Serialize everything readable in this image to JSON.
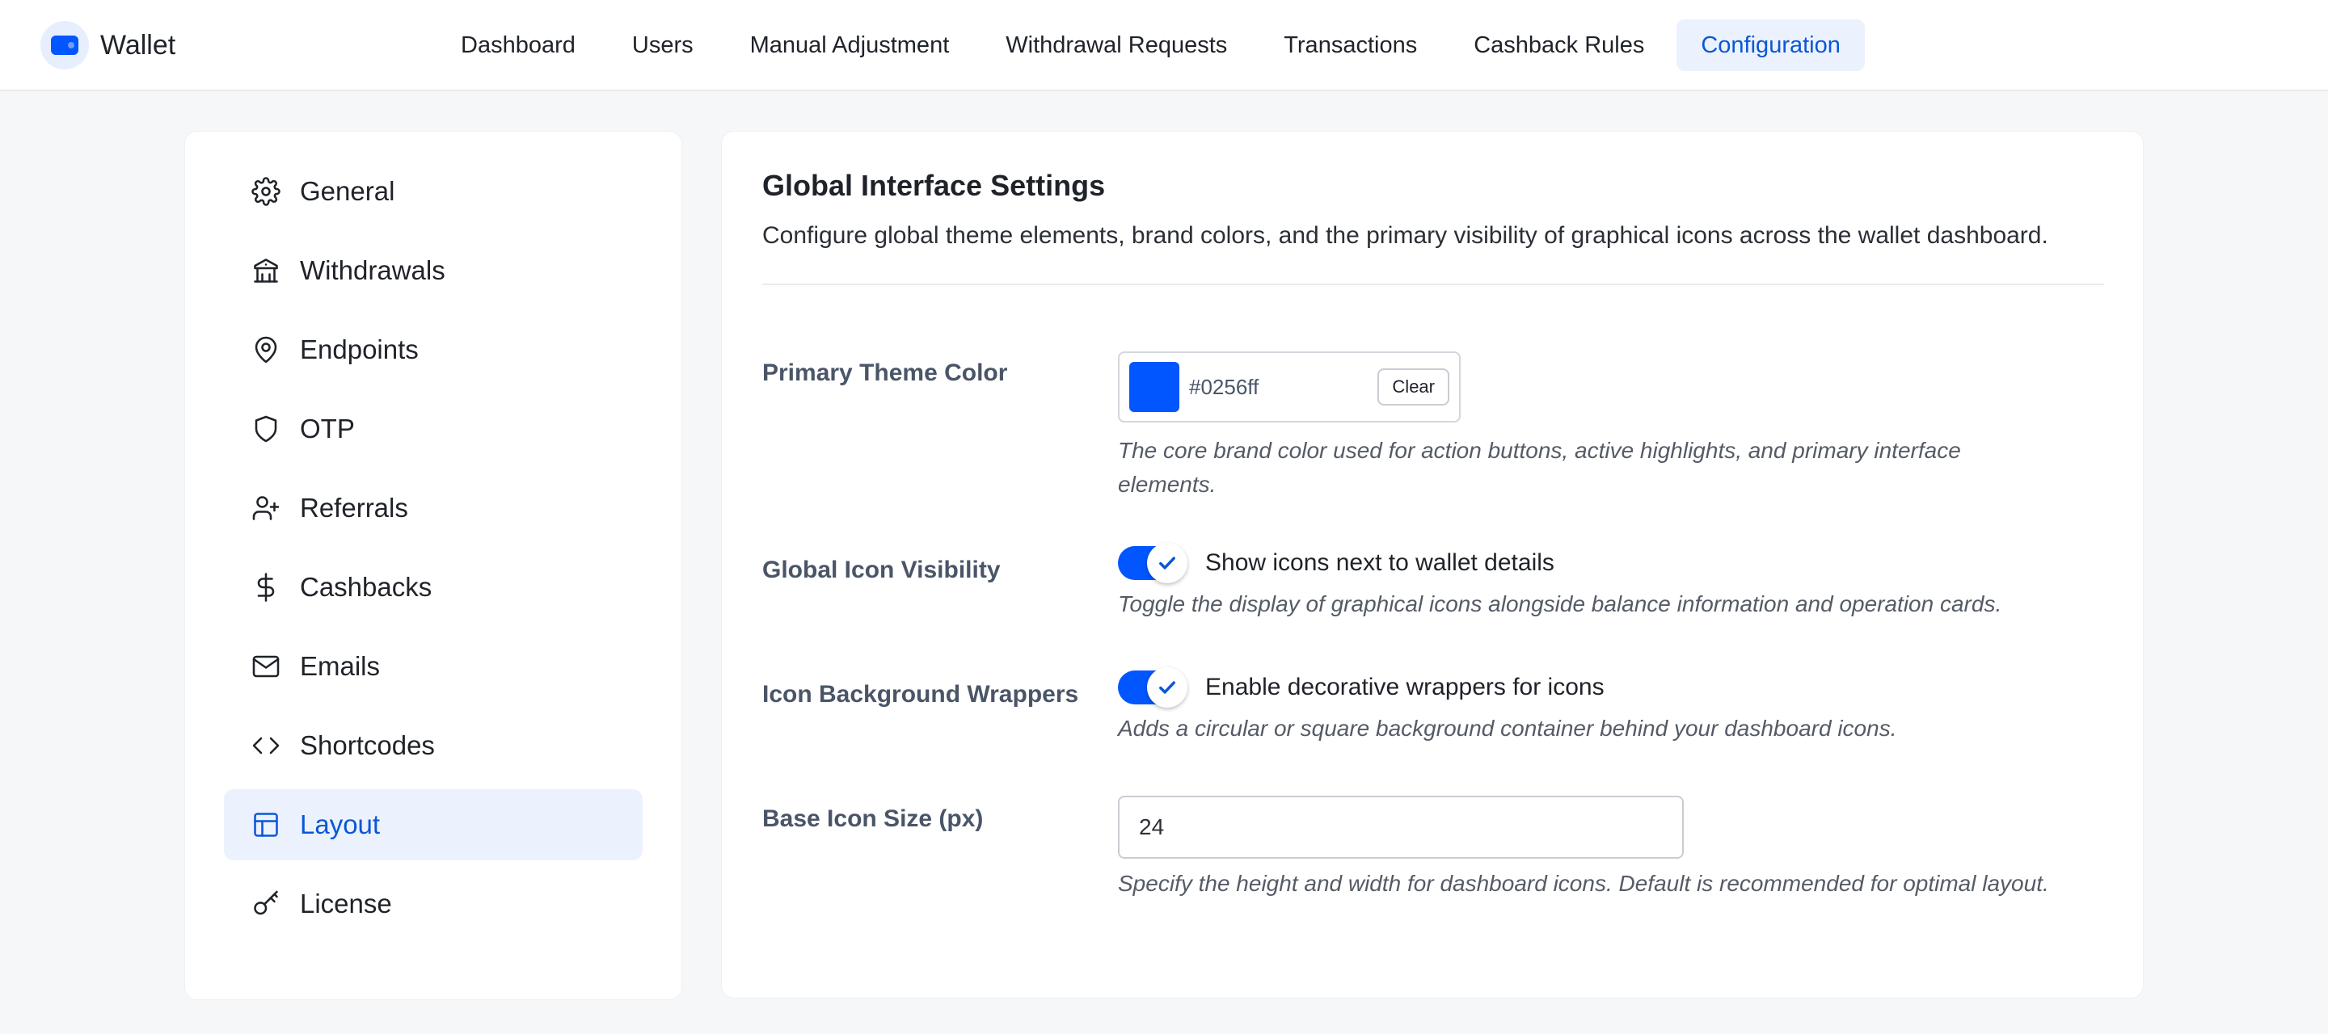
{
  "brand": {
    "name": "Wallet",
    "icon": "wallet-icon",
    "accent": "#0256ff"
  },
  "nav": {
    "items": [
      {
        "label": "Dashboard"
      },
      {
        "label": "Users"
      },
      {
        "label": "Manual Adjustment"
      },
      {
        "label": "Withdrawal Requests"
      },
      {
        "label": "Transactions"
      },
      {
        "label": "Cashback Rules"
      },
      {
        "label": "Configuration",
        "active": true
      }
    ]
  },
  "sidebar": {
    "items": [
      {
        "label": "General",
        "icon": "gear-icon"
      },
      {
        "label": "Withdrawals",
        "icon": "bank-icon"
      },
      {
        "label": "Endpoints",
        "icon": "map-pin-icon"
      },
      {
        "label": "OTP",
        "icon": "shield-icon"
      },
      {
        "label": "Referrals",
        "icon": "user-plus-icon"
      },
      {
        "label": "Cashbacks",
        "icon": "dollar-icon"
      },
      {
        "label": "Emails",
        "icon": "mail-icon"
      },
      {
        "label": "Shortcodes",
        "icon": "code-icon"
      },
      {
        "label": "Layout",
        "icon": "layout-icon",
        "active": true
      },
      {
        "label": "License",
        "icon": "key-icon"
      }
    ]
  },
  "main": {
    "title": "Global Interface Settings",
    "description": "Configure global theme elements, brand colors, and the primary visibility of graphical icons across the wallet dashboard.",
    "primary_color": {
      "label": "Primary Theme Color",
      "value": "#0256ff",
      "clear_label": "Clear",
      "help": "The core brand color used for action buttons, active highlights, and primary interface elements."
    },
    "icon_visibility": {
      "label": "Global Icon Visibility",
      "toggle_label": "Show icons next to wallet details",
      "enabled": true,
      "help": "Toggle the display of graphical icons alongside balance information and operation cards."
    },
    "icon_wrappers": {
      "label": "Icon Background Wrappers",
      "toggle_label": "Enable decorative wrappers for icons",
      "enabled": true,
      "help": "Adds a circular or square background container behind your dashboard icons."
    },
    "icon_size": {
      "label": "Base Icon Size (px)",
      "value": "24",
      "help": "Specify the height and width for dashboard icons. Default is recommended for optimal layout."
    }
  }
}
